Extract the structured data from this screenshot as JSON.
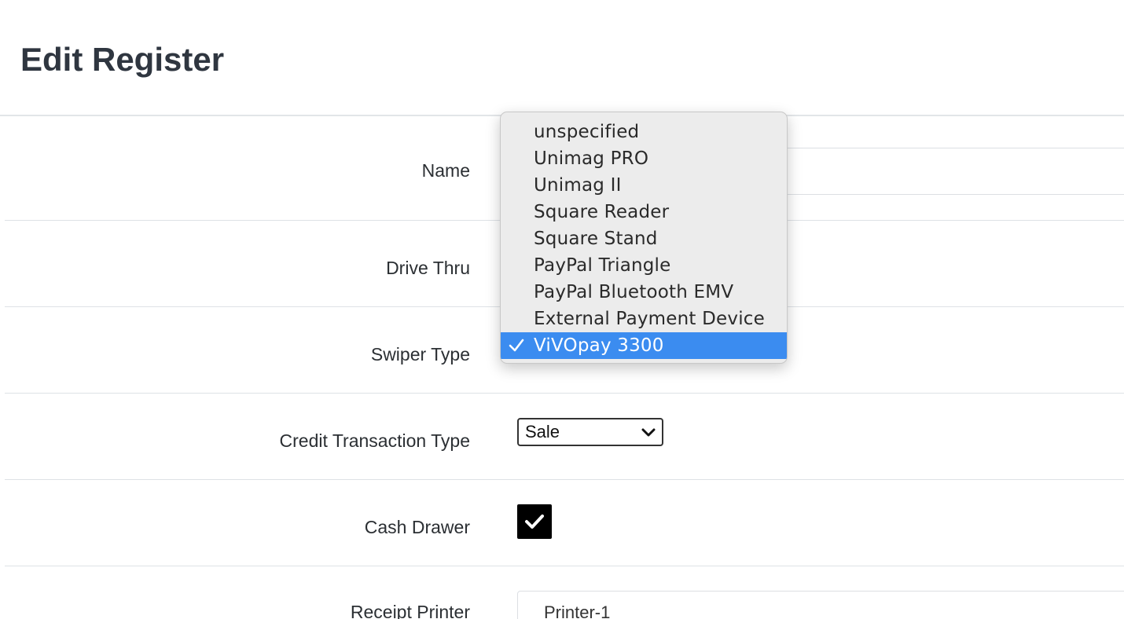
{
  "page": {
    "title": "Edit Register"
  },
  "form": {
    "name_label": "Name",
    "drive_thru_label": "Drive Thru",
    "swiper_type_label": "Swiper Type",
    "credit_transaction_type_label": "Credit Transaction Type",
    "credit_transaction_type_value": "Sale",
    "cash_drawer_label": "Cash Drawer",
    "cash_drawer_checked": true,
    "receipt_printer_label": "Receipt Printer",
    "receipt_printer_value": "Printer-1"
  },
  "swiper_dropdown": {
    "options": [
      {
        "label": "unspecified",
        "selected": false
      },
      {
        "label": "Unimag PRO",
        "selected": false
      },
      {
        "label": "Unimag II",
        "selected": false
      },
      {
        "label": "Square Reader",
        "selected": false
      },
      {
        "label": "Square Stand",
        "selected": false
      },
      {
        "label": "PayPal Triangle",
        "selected": false
      },
      {
        "label": "PayPal Bluetooth EMV",
        "selected": false
      },
      {
        "label": "External Payment Device",
        "selected": false
      },
      {
        "label": "ViVOpay 3300",
        "selected": true
      }
    ],
    "selected_color": "#3b8cf0"
  },
  "icons": {
    "dropdown_chevron": "chevron-down-icon",
    "checkbox_check": "checkmark-icon",
    "selected_check": "checkmark-icon"
  }
}
